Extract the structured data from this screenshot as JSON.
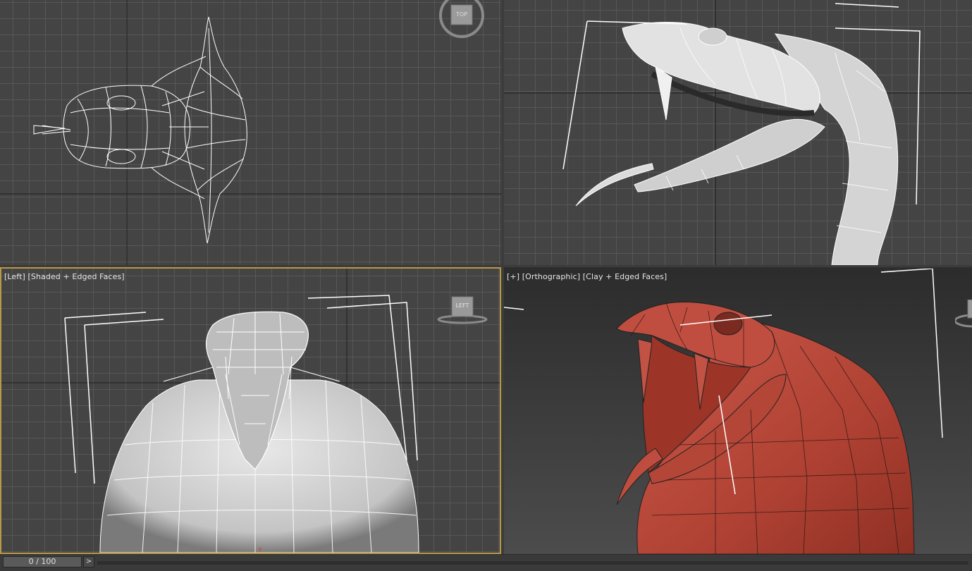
{
  "viewports": {
    "top": {
      "cube_label": "TOP"
    },
    "front": {
      "label": ""
    },
    "left": {
      "label": "[Left] [Shaded + Edged Faces]",
      "cube_label": "LEFT",
      "axis_label": "Y"
    },
    "perspective": {
      "label": "[+] [Orthographic] [Clay + Edged Faces]"
    }
  },
  "timeline": {
    "frame_counter": "0 / 100",
    "next_label": ">"
  },
  "colors": {
    "active_border": "#b89a45",
    "clay": "#b84a3c",
    "wire": "#ffffff"
  }
}
